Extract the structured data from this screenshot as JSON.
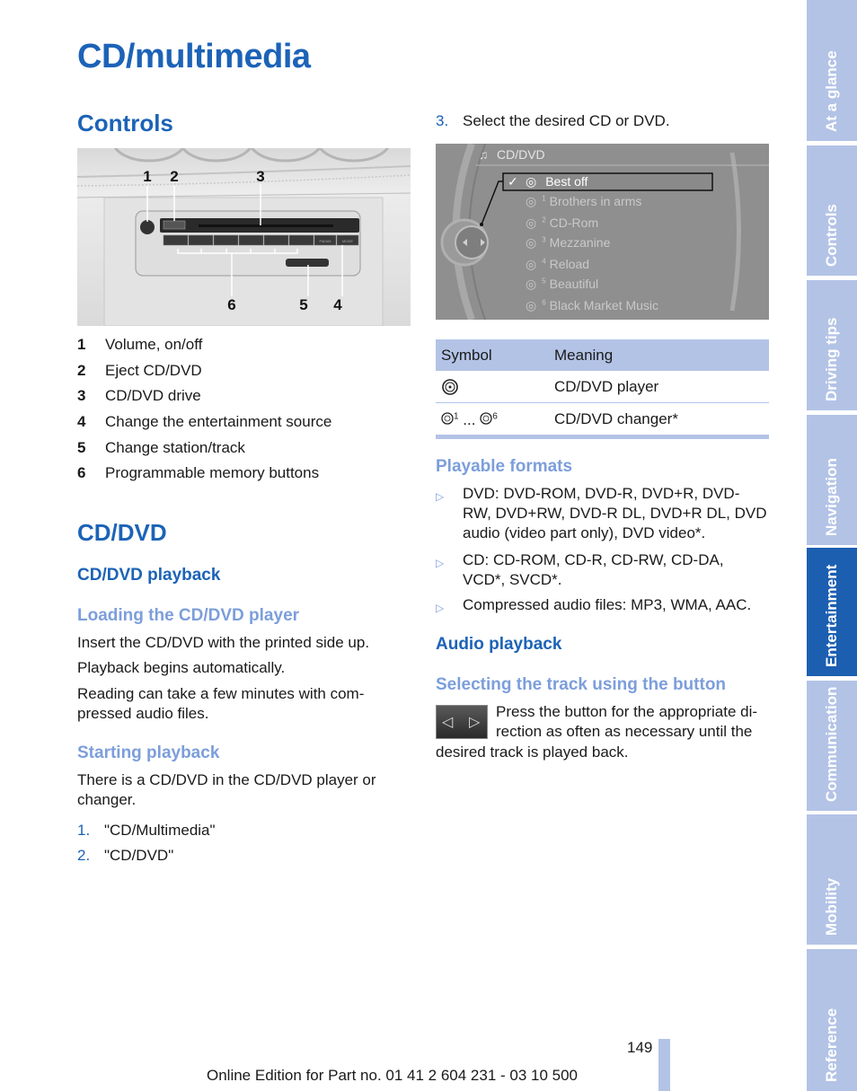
{
  "page": {
    "title": "CD/multimedia",
    "page_number": "149",
    "footer": "Online Edition for Part no. 01 41 2 604 231 - 03 10 500"
  },
  "controls": {
    "heading": "Controls",
    "figure_callouts": [
      "1",
      "2",
      "3",
      "6",
      "5",
      "4"
    ],
    "panel_labels": {
      "presets": [
        "1",
        "2",
        "3",
        "4",
        "5",
        "6"
      ],
      "fm_am": "FM/AM",
      "mode": "MODE"
    },
    "legend": [
      {
        "num": "1",
        "text": "Volume, on/off"
      },
      {
        "num": "2",
        "text": "Eject CD/DVD"
      },
      {
        "num": "3",
        "text": "CD/DVD drive"
      },
      {
        "num": "4",
        "text": "Change the entertainment source"
      },
      {
        "num": "5",
        "text": "Change station/track"
      },
      {
        "num": "6",
        "text": "Programmable memory buttons"
      }
    ]
  },
  "cddvd": {
    "heading": "CD/DVD",
    "playback_heading": "CD/DVD playback",
    "loading_heading": "Loading the CD/DVD player",
    "loading_paragraphs": [
      "Insert the CD/DVD with the printed side up.",
      "Playback begins automatically.",
      "Reading can take a few minutes with com-",
      "pressed audio files."
    ],
    "starting_heading": "Starting playback",
    "starting_paragraph": [
      "There is a CD/DVD in the CD/DVD player or",
      "changer."
    ],
    "steps": [
      {
        "n": "1.",
        "text": "\"CD/Multimedia\""
      },
      {
        "n": "2.",
        "text": "\"CD/DVD\""
      },
      {
        "n": "3.",
        "text": "Select the desired CD or DVD."
      }
    ]
  },
  "screen": {
    "title": "CD/DVD",
    "selected_check": "✓",
    "items": [
      {
        "label": "Best off",
        "slot": "",
        "selected": true
      },
      {
        "label": "Brothers in arms",
        "slot": "1",
        "selected": false
      },
      {
        "label": "CD-Rom",
        "slot": "2",
        "selected": false
      },
      {
        "label": "Mezzanine",
        "slot": "3",
        "selected": false
      },
      {
        "label": "Reload",
        "slot": "4",
        "selected": false
      },
      {
        "label": "Beautiful",
        "slot": "5",
        "selected": false
      },
      {
        "label": "Black Market Music",
        "slot": "6",
        "selected": false
      }
    ]
  },
  "symbol_table": {
    "headers": [
      "Symbol",
      "Meaning"
    ],
    "rows": [
      {
        "symbol": "cd-player-icon",
        "symbol_text": "",
        "meaning": "CD/DVD player"
      },
      {
        "symbol": "cd-changer-icon",
        "symbol_text": "...",
        "meaning": "CD/DVD changer*"
      }
    ],
    "changer_slots": [
      "1",
      "6"
    ]
  },
  "formats": {
    "heading": "Playable formats",
    "items": [
      [
        "DVD: DVD-ROM, DVD-R, DVD+R, DVD-",
        "RW, DVD+RW, DVD-R DL, DVD+R DL, DVD",
        "audio (video part only), DVD video*."
      ],
      [
        "CD: CD-ROM, CD-R, CD-RW, CD-DA,",
        "VCD*, SVCD*."
      ],
      [
        "Compressed audio files: MP3, WMA, AAC."
      ]
    ]
  },
  "audio": {
    "heading": "Audio playback",
    "subheading": "Selecting the track using the button",
    "text_lines": [
      "Press the button for the appropriate di-",
      "rection as often as necessary until the",
      "desired track is played back."
    ]
  },
  "side_tabs": [
    {
      "label": "At a glance",
      "active": false
    },
    {
      "label": "Controls",
      "active": false
    },
    {
      "label": "Driving tips",
      "active": false
    },
    {
      "label": "Navigation",
      "active": false
    },
    {
      "label": "Entertainment",
      "active": true
    },
    {
      "label": "Communication",
      "active": false
    },
    {
      "label": "Mobility",
      "active": false
    },
    {
      "label": "Reference",
      "active": false
    }
  ],
  "colors": {
    "heading_blue": "#1c63b7",
    "subheading_light_blue": "#7c9edb",
    "tab_light": "#b3c3e6",
    "tab_active": "#1c5fb1"
  }
}
